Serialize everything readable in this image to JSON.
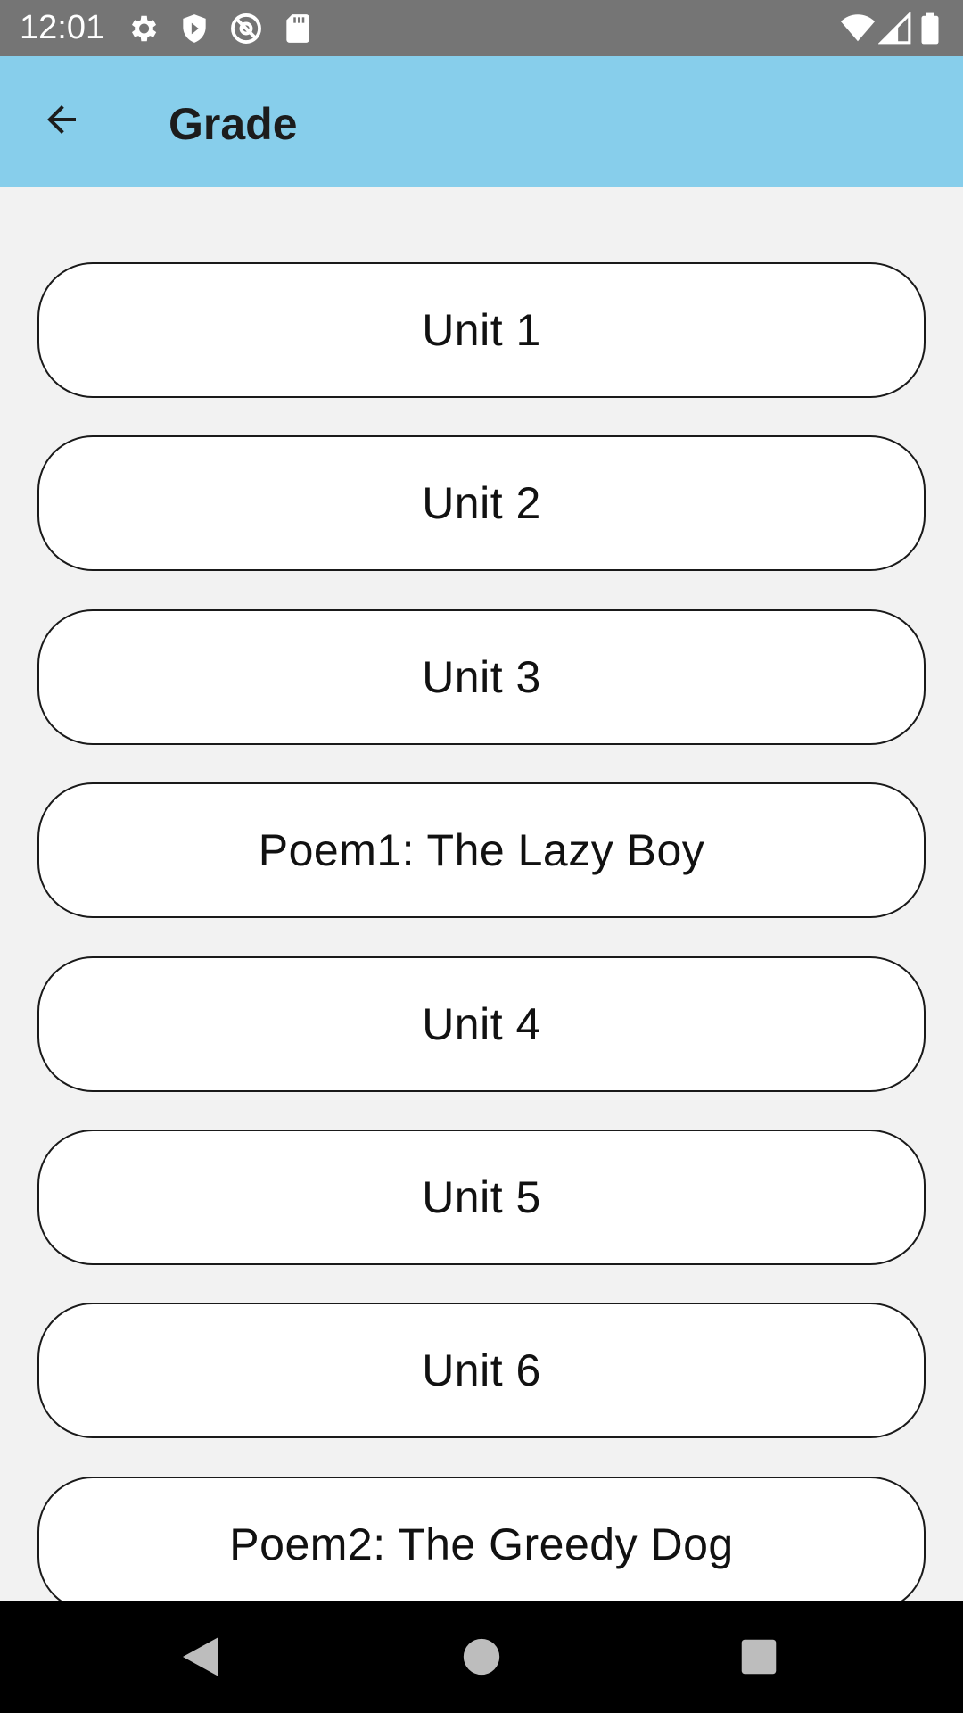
{
  "status_bar": {
    "time": "12:01",
    "left_icons": [
      "gear-icon",
      "shield-icon",
      "at-sign-icon",
      "sd-card-icon"
    ],
    "right_icons": [
      "wifi-icon",
      "signal-icon",
      "battery-icon"
    ]
  },
  "app_bar": {
    "title": "Grade",
    "back_icon": "arrow-left-icon",
    "color": "#87ceeb"
  },
  "units": [
    {
      "label": "Unit 1"
    },
    {
      "label": "Unit 2"
    },
    {
      "label": "Unit 3"
    },
    {
      "label": "Poem1: The Lazy Boy"
    },
    {
      "label": "Unit 4"
    },
    {
      "label": "Unit 5"
    },
    {
      "label": "Unit 6"
    },
    {
      "label": "Poem2: The Greedy Dog"
    }
  ],
  "nav_bar": {
    "buttons": [
      "back-triangle-icon",
      "home-circle-icon",
      "recents-square-icon"
    ]
  }
}
